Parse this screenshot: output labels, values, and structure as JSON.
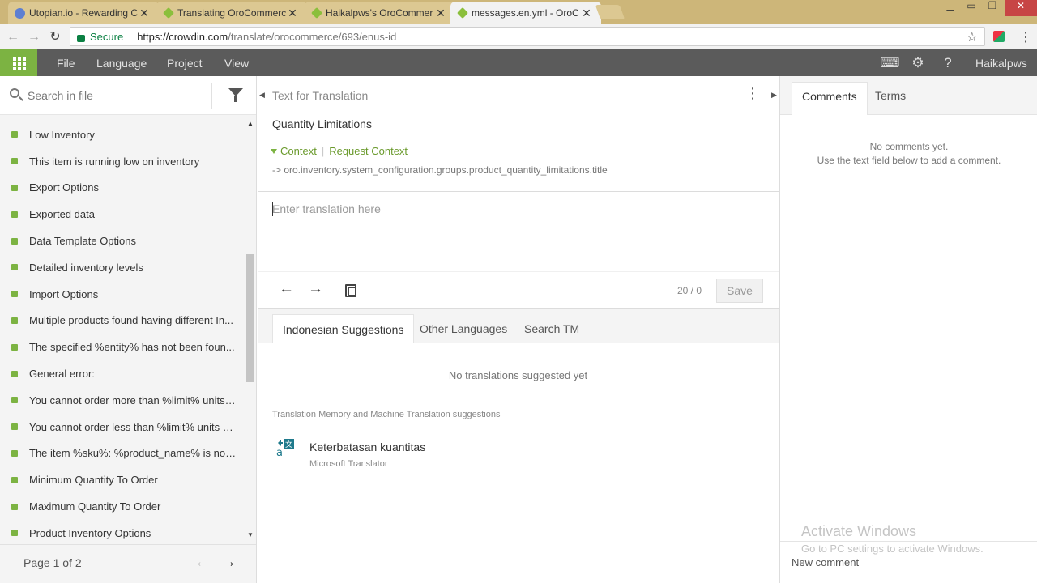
{
  "browser": {
    "tabs": [
      {
        "title": "Utopian.io - Rewarding C",
        "favicon": "utopian-icon",
        "active": false
      },
      {
        "title": "Translating OroCommerc",
        "favicon": "crowdin-icon",
        "active": false
      },
      {
        "title": "Haikalpws's OroCommer",
        "favicon": "crowdin-icon",
        "active": false
      },
      {
        "title": "messages.en.yml - OroC",
        "favicon": "crowdin-icon",
        "active": true
      }
    ],
    "secure_label": "Secure",
    "url_host": "https://crowdin.com",
    "url_path": "/translate/orocommerce/693/enus-id"
  },
  "appnav": {
    "menu": [
      "File",
      "Language",
      "Project",
      "View"
    ],
    "username": "Haikalpws"
  },
  "sidebar": {
    "search_placeholder": "Search in file",
    "strings": [
      "Low Inventory",
      "This item is running low on inventory",
      "Export Options",
      "Exported data",
      "Data Template Options",
      "Detailed inventory levels",
      "Import Options",
      "Multiple products found having different In...",
      "The specified %entity% has not been foun...",
      "General error:",
      "You cannot order more than %limit% units ...",
      "You cannot order less than %limit% units o...",
      "The item %sku%: %product_name% is not ...",
      "Minimum Quantity To Order",
      "Maximum Quantity To Order",
      "Product Inventory Options"
    ],
    "page_label": "Page 1 of 2"
  },
  "editor": {
    "header": "Text for Translation",
    "source_text": "Quantity Limitations",
    "context_label": "Context",
    "request_context_label": "Request Context",
    "key_path": "-> oro.inventory.system_configuration.groups.product_quantity_limitations.title",
    "translation_placeholder": "Enter translation here",
    "char_count": "20 / 0",
    "save_label": "Save"
  },
  "suggestions": {
    "tabs": [
      "Indonesian Suggestions",
      "Other Languages",
      "Search TM"
    ],
    "empty_text": "No translations suggested yet",
    "tm_header": "Translation Memory and Machine Translation suggestions",
    "machine": {
      "text": "Keterbatasan kuantitas",
      "source": "Microsoft Translator"
    }
  },
  "comments": {
    "tabs": [
      "Comments",
      "Terms"
    ],
    "empty_line1": "No comments yet.",
    "empty_line2": "Use the text field below to add a comment.",
    "new_comment_label": "New comment"
  },
  "watermark": {
    "title": "Activate Windows",
    "subtitle": "Go to PC settings to activate Windows."
  }
}
